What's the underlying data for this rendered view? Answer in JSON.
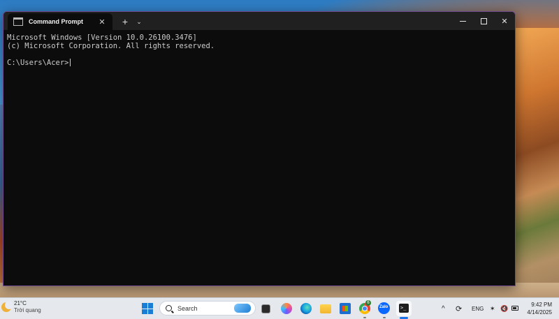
{
  "window": {
    "tab_title": "Command Prompt",
    "new_tab_symbol": "+",
    "dropdown_symbol": "⌄",
    "close_tab_symbol": "✕",
    "close_symbol": "✕"
  },
  "console": {
    "lines": [
      "Microsoft Windows [Version 10.0.26100.3476]",
      "(c) Microsoft Corporation. All rights reserved.",
      "",
      "C:\\Users\\Acer>"
    ]
  },
  "taskbar": {
    "weather": {
      "temperature": "21°C",
      "condition": "Trời quang"
    },
    "search": {
      "label": "Search"
    },
    "chrome_badge": "6",
    "zalo_label": "Zalo",
    "tray": {
      "language": "ENG",
      "chevron": "^",
      "sync": "⟳",
      "wifi": "✶",
      "volume": "🔇"
    },
    "clock": {
      "time": "9:42 PM",
      "date": "4/14/2025"
    },
    "terminal_glyph": ">_"
  },
  "colors": {
    "console_bg": "#0c0c0c",
    "console_fg": "#cccccc",
    "window_border": "#6f4a8c",
    "accent": "#1a73e8"
  }
}
